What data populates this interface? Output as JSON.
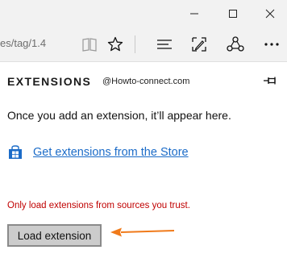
{
  "window_controls": {
    "minimize_icon": "minimize-icon",
    "maximize_icon": "maximize-icon",
    "close_icon": "close-icon"
  },
  "address_bar": {
    "url_text": "es/tag/1.4"
  },
  "toolbar_icons": [
    "reading-view-icon",
    "favorite-star-icon",
    "hub-icon",
    "web-note-icon",
    "share-icon",
    "more-icon"
  ],
  "panel": {
    "title": "EXTENSIONS",
    "watermark": "@Howto-connect.com",
    "pin_icon": "pin-icon",
    "empty_message": "Once you add an extension, it’ll appear here.",
    "store_link": "Get extensions from the Store",
    "store_icon": "windows-store-icon",
    "warning": "Only load extensions from sources you trust.",
    "load_button": "Load extension"
  },
  "colors": {
    "chrome_bg": "#f2f2f2",
    "link": "#1c6cc8",
    "warning": "#c00000",
    "annotation_arrow": "#f07a1a"
  }
}
